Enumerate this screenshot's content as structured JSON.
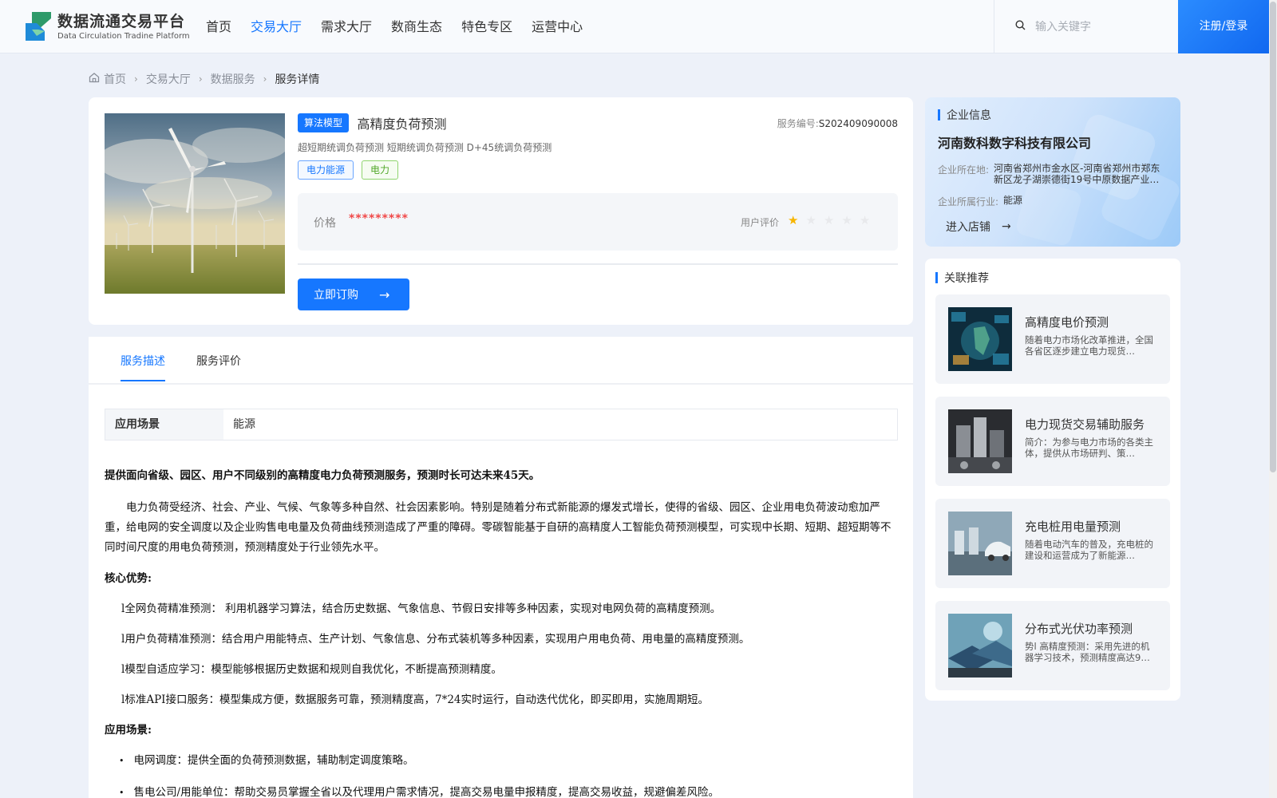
{
  "header": {
    "logo_title": "数据流通交易平台",
    "logo_subtitle": "Data Circulation Tradine Platform",
    "nav": [
      "首页",
      "交易大厅",
      "需求大厅",
      "数商生态",
      "特色专区",
      "运营中心"
    ],
    "nav_active": "交易大厅",
    "search_placeholder": "输入关键字",
    "login_label": "注册/登录",
    "accent_color": "#1677ff"
  },
  "breadcrumb": {
    "items": [
      "首页",
      "交易大厅",
      "数据服务"
    ],
    "current": "服务详情"
  },
  "product": {
    "category_badge": "算法模型",
    "title": "高精度负荷预测",
    "code_label": "服务编号:",
    "code_value": "S202409090008",
    "description": "超短期统调负荷预测 短期统调负荷预测 D+45统调负荷预测",
    "tags": [
      "电力能源",
      "电力"
    ],
    "price_label": "价格",
    "price_value": "*********",
    "rating_label": "用户评价",
    "rating": 1,
    "rating_max": 5,
    "buy_label": "立即订购"
  },
  "tabs": {
    "items": [
      "服务描述",
      "服务评价"
    ],
    "active": "服务描述"
  },
  "description": {
    "scene_header": "应用场景",
    "scene_value": "能源",
    "lead": "提供面向省级、园区、用户不同级别的高精度电力负荷预测服务，预测时长可达未来45天。",
    "paragraph": "电力负荷受经济、社会、产业、气候、气象等多种自然、社会因素影响。特别是随着分布式新能源的爆发式增长，使得的省级、园区、企业用电负荷波动愈加严重，给电网的安全调度以及企业购售电电量及负荷曲线预测造成了严重的障碍。零碳智能基于自研的高精度人工智能负荷预测模型，可实现中长期、短期、超短期等不同时间尺度的用电负荷预测，预测精度处于行业领先水平。",
    "advantages_title": "核心优势:",
    "advantages": [
      "l全网负荷精准预测：  利用机器学习算法，结合历史数据、气象信息、节假日安排等多种因素，实现对电网负荷的高精度预测。",
      "l用户负荷精准预测：结合用户用能特点、生产计划、气象信息、分布式装机等多种因素，实现用户用电负荷、用电量的高精度预测。",
      "l模型自适应学习：模型能够根据历史数据和规则自我优化，不断提高预测精度。",
      "l标准API接口服务：模型集成方便，数据服务可靠，预测精度高，7*24实时运行，自动迭代优化，即买即用，实施周期短。"
    ],
    "scenes_title": "应用场景:",
    "scenes": [
      "电网调度：提供全面的负荷预测数据，辅助制定调度策略。",
      "售电公司/用能单位：帮助交易员掌握全省以及代理用户需求情况，提高交易电量申报精度，提高交易收益，规避偏差风险。"
    ]
  },
  "company": {
    "section_title": "企业信息",
    "name": "河南数科数字科技有限公司",
    "location_label": "企业所在地:",
    "location_value": "河南省郑州市金水区-河南省郑州市郑东新区龙子湖崇德街19号中原数据产业…",
    "industry_label": "企业所属行业:",
    "industry_value": "能源",
    "enter_shop_label": "进入店铺"
  },
  "recommendations": {
    "section_title": "关联推荐",
    "items": [
      {
        "title": "高精度电价预测",
        "desc": "随着电力市场化改革推进，全国各省区逐步建立电力现货…"
      },
      {
        "title": "电力现货交易辅助服务",
        "desc": "简介：为参与电力市场的各类主体，提供从市场研判、策…"
      },
      {
        "title": "充电桩用电量预测",
        "desc": "随着电动汽车的普及，充电桩的建设和运营成为了新能源…"
      },
      {
        "title": "分布式光伏功率预测",
        "desc": "势l 高精度预测：采用先进的机器学习技术，预测精度高达9…"
      }
    ]
  }
}
